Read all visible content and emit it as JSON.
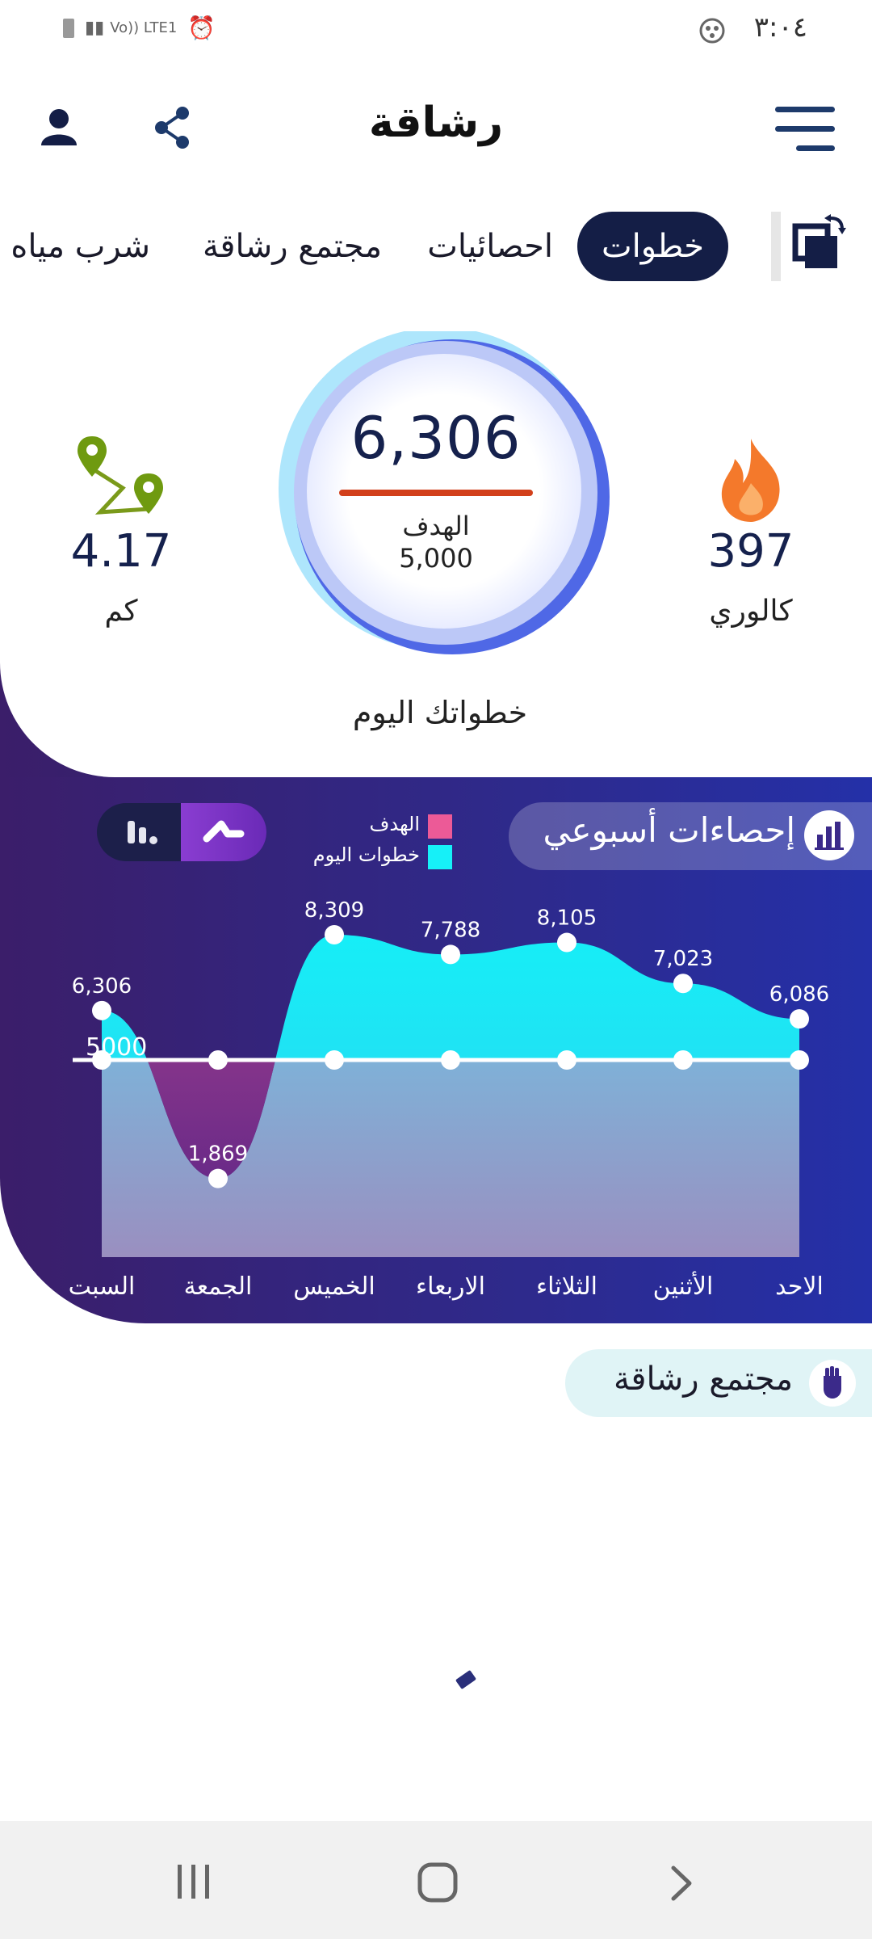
{
  "status_bar": {
    "time": "٣:٠٤",
    "network": "Vo)) LTE1"
  },
  "header": {
    "title": "رشاقة",
    "icons": [
      "menu-icon",
      "share-icon",
      "user-icon"
    ]
  },
  "tabs": [
    {
      "label": "خطوات",
      "active": true
    },
    {
      "label": "احصائيات",
      "active": false
    },
    {
      "label": "مجتمع رشاقة",
      "active": false
    },
    {
      "label": "شرب مياه",
      "active": false
    }
  ],
  "summary": {
    "steps": "6,306",
    "goal_label": "الهدف",
    "goal_value": "5,000",
    "today_label": "خطواتك اليوم",
    "calories_value": "397",
    "calories_label": "كالوري",
    "distance_value": "4.17",
    "distance_label": "كم"
  },
  "weekly": {
    "title": "إحصاءات أسبوعي",
    "legend_goal": "الهدف",
    "legend_today": "خطوات اليوم",
    "goal_line_label": "5000"
  },
  "chart_data": {
    "type": "area",
    "categories": [
      "السبت",
      "الجمعة",
      "الخميس",
      "الاربعاء",
      "الثلاثاء",
      "الأثنين",
      "الاحد"
    ],
    "series": [
      {
        "name": "خطوات اليوم",
        "values": [
          6306,
          1869,
          8309,
          7788,
          8105,
          7023,
          6086
        ]
      },
      {
        "name": "الهدف",
        "values": [
          5000,
          5000,
          5000,
          5000,
          5000,
          5000,
          5000
        ]
      }
    ],
    "labels": [
      "6,306",
      "1,869",
      "8,309",
      "7,788",
      "8,105",
      "7,023",
      "6,086"
    ],
    "colors": {
      "today": "#16f0f8",
      "goal": "#ec5a97"
    }
  },
  "community": {
    "title": "مجتمع رشاقة"
  }
}
